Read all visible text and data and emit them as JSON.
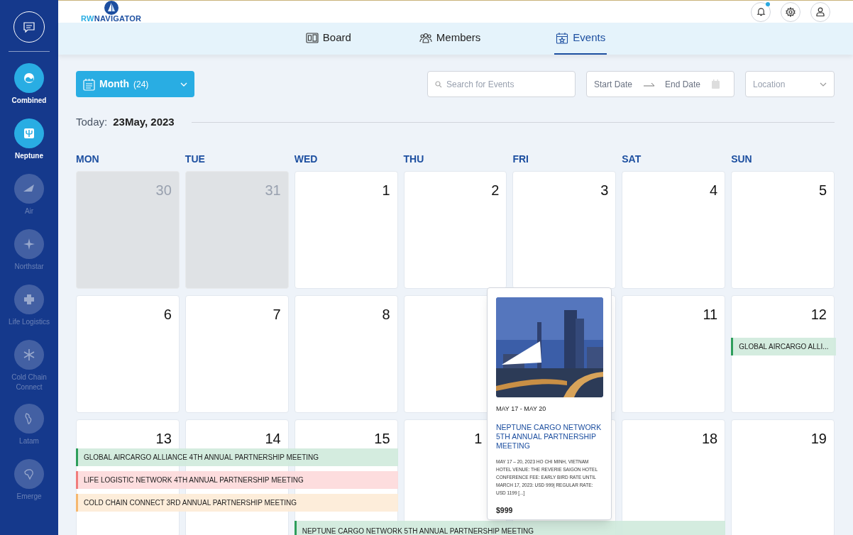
{
  "sidebar": {
    "items": [
      {
        "label": "Combined",
        "active": true
      },
      {
        "label": "Neptune",
        "active": true
      },
      {
        "label": "Air",
        "active": false
      },
      {
        "label": "Northstar",
        "active": false
      },
      {
        "label": "Life Logistics",
        "active": false
      },
      {
        "label": "Cold Chain Connect",
        "active": false
      },
      {
        "label": "Latam",
        "active": false
      },
      {
        "label": "Emerge",
        "active": false
      }
    ]
  },
  "header": {
    "logo": {
      "parts": [
        "RW",
        "NAVIGATOR"
      ]
    },
    "has_notification": true
  },
  "tabs": [
    {
      "label": "Board",
      "selected": false
    },
    {
      "label": "Members",
      "selected": false
    },
    {
      "label": "Events",
      "selected": true
    }
  ],
  "toolbar": {
    "view": {
      "label": "Month",
      "count": "(24)"
    },
    "search": {
      "placeholder": "Search for Events"
    },
    "start_date": {
      "placeholder": "Start Date"
    },
    "end_date": {
      "placeholder": "End Date"
    },
    "location": {
      "placeholder": "Location"
    }
  },
  "today": {
    "label": "Today:",
    "date": "23May, 2023"
  },
  "weekdays": [
    "MON",
    "TUE",
    "WED",
    "THU",
    "FRI",
    "SAT",
    "SUN"
  ],
  "weeks": [
    [
      {
        "day": "30",
        "muted": true
      },
      {
        "day": "31",
        "muted": true
      },
      {
        "day": "1",
        "muted": false
      },
      {
        "day": "2",
        "muted": false
      },
      {
        "day": "3",
        "muted": false
      },
      {
        "day": "4",
        "muted": false
      },
      {
        "day": "5",
        "muted": false
      }
    ],
    [
      {
        "day": "6",
        "muted": false
      },
      {
        "day": "7",
        "muted": false
      },
      {
        "day": "8",
        "muted": false
      },
      {
        "muted": false
      },
      {
        "muted": false
      },
      {
        "day": "11",
        "muted": false
      },
      {
        "day": "12",
        "muted": false
      }
    ],
    [
      {
        "day": "13",
        "muted": false
      },
      {
        "day": "14",
        "muted": false
      },
      {
        "day": "15",
        "muted": false
      },
      {
        "day": "1",
        "muted": false
      },
      {
        "muted": false
      },
      {
        "day": "18",
        "muted": false
      },
      {
        "day": "19",
        "muted": false
      }
    ]
  ],
  "events": [
    {
      "title": "GLOBAL AIRCARGO ALLI...",
      "color": "#2e9e5b"
    },
    {
      "title": "GLOBAL AIRCARGO ALLIANCE 4TH ANNUAL PARTNERSHIP MEETING",
      "color": "#2e9e5b"
    },
    {
      "title": "LIFE LOGISTIC NETWORK 4TH ANNUAL PARTNERSHIP MEETING",
      "color": "#f07c7c"
    },
    {
      "title": "COLD CHAIN CONNECT 3RD ANNUAL PARTNERSHIP MEETING",
      "color": "#f5b870"
    },
    {
      "title": "NEPTUNE CARGO NETWORK 5TH ANNUAL PARTNERSHIP MEETING",
      "color": "#2e9e5b"
    }
  ],
  "popover": {
    "dates": "MAY 17 - MAY 20",
    "title": "NEPTUNE CARGO NETWORK 5TH ANNUAL PARTNERSHIP MEETING",
    "description": "MAY 17 – 20, 2023 HO CHI MINH, VIETNAM HOTEL VENUE: THE REVERIE SAIGON HOTEL CONFERENCE FEE: EARLY BIRD RATE UNTIL MARCH 17, 2023: USD 999| REGULAR RATE: USD 1199 [...]",
    "price": "$999"
  }
}
